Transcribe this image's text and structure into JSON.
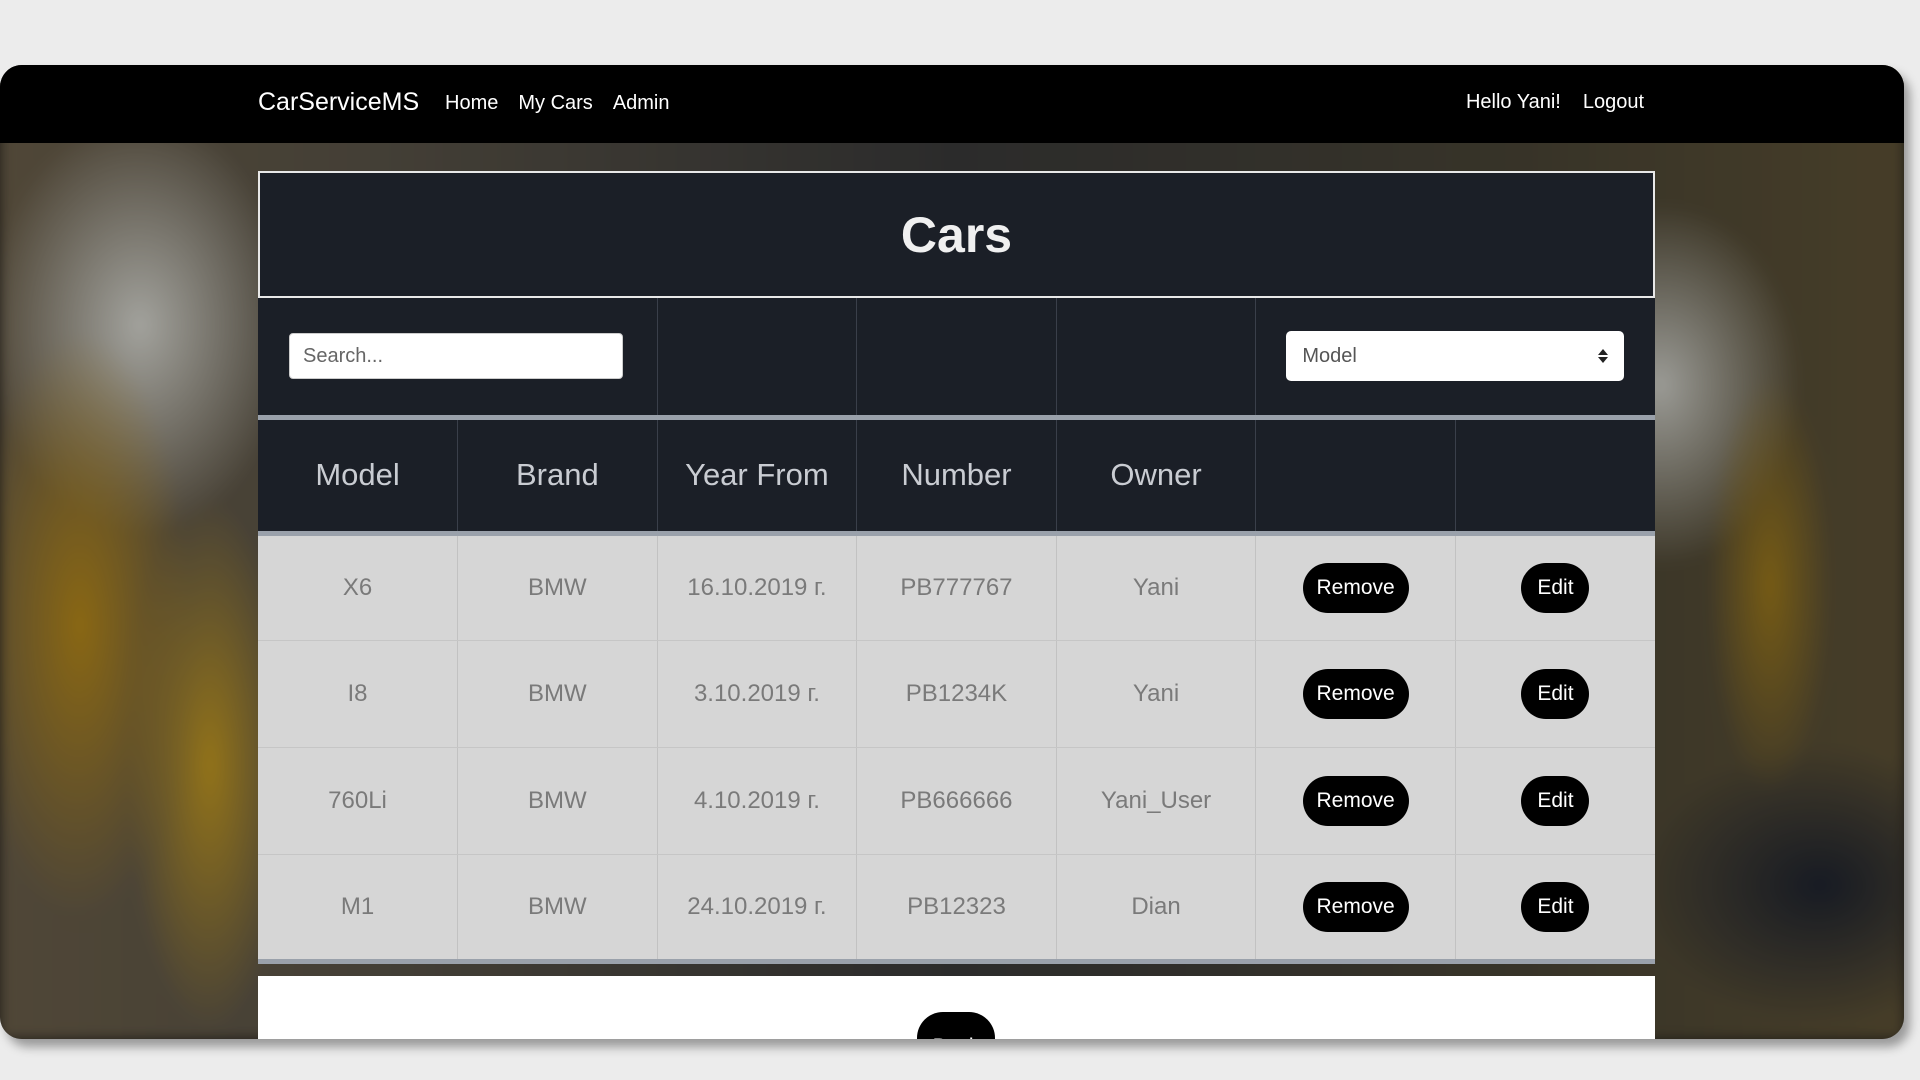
{
  "navbar": {
    "brand": "CarServiceMS",
    "links": [
      {
        "label": "Home"
      },
      {
        "label": "My Cars"
      },
      {
        "label": "Admin"
      }
    ],
    "greeting": "Hello Yani!",
    "logout": "Logout"
  },
  "page": {
    "title": "Cars"
  },
  "filters": {
    "search_placeholder": "Search...",
    "search_value": "",
    "sort_selected": "Model"
  },
  "table": {
    "columns": [
      "Model",
      "Brand",
      "Year From",
      "Number",
      "Owner",
      "",
      ""
    ],
    "rows": [
      {
        "model": "X6",
        "brand": "BMW",
        "year_from": "16.10.2019 г.",
        "number": "PB777767",
        "owner": "Yani"
      },
      {
        "model": "I8",
        "brand": "BMW",
        "year_from": "3.10.2019 г.",
        "number": "PB1234K",
        "owner": "Yani"
      },
      {
        "model": "760Li",
        "brand": "BMW",
        "year_from": "4.10.2019 г.",
        "number": "PB666666",
        "owner": "Yani_User"
      },
      {
        "model": "M1",
        "brand": "BMW",
        "year_from": "24.10.2019 г.",
        "number": "PB12323",
        "owner": "Dian"
      }
    ],
    "remove_label": "Remove",
    "edit_label": "Edit"
  },
  "footer": {
    "back_label": "Back"
  }
}
